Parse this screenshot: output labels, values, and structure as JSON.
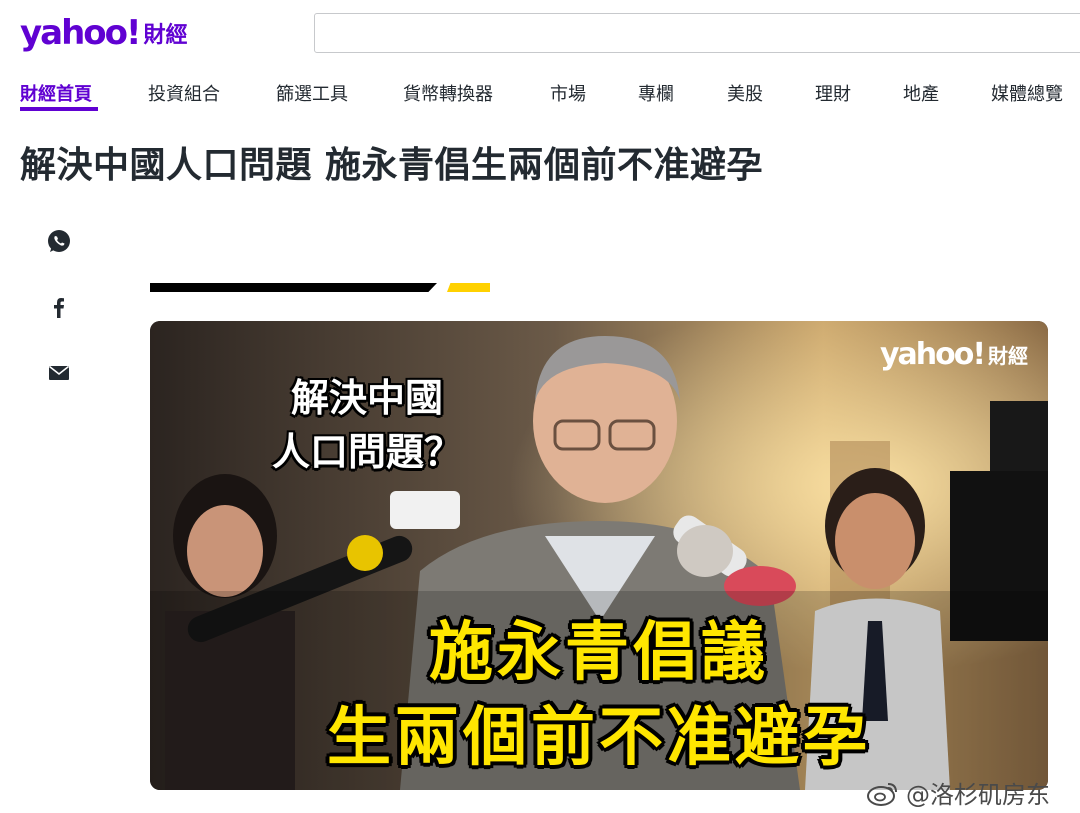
{
  "header": {
    "logo_text": "yahoo!",
    "logo_sub": "財經",
    "search_placeholder": ""
  },
  "nav": {
    "items": [
      {
        "label": "財經首頁",
        "active": true
      },
      {
        "label": "投資組合"
      },
      {
        "label": "篩選工具"
      },
      {
        "label": "貨幣轉換器"
      },
      {
        "label": "市場"
      },
      {
        "label": "專欄"
      },
      {
        "label": "美股"
      },
      {
        "label": "理財"
      },
      {
        "label": "地產"
      },
      {
        "label": "媒體總覽"
      }
    ]
  },
  "article": {
    "title": "解決中國人口問題 施永青倡生兩個前不准避孕"
  },
  "share": {
    "icons": [
      "whatsapp-icon",
      "facebook-icon",
      "mail-icon"
    ]
  },
  "hero": {
    "small_line1": "解決中國",
    "small_line2": "人口問題？",
    "big_line1": "施永青倡議",
    "big_line2": "生兩個前不准避孕",
    "logo_text": "yahoo!",
    "logo_sub": "財經"
  },
  "watermark": {
    "text": "@洛杉矶房东",
    "icon": "weibo-icon"
  },
  "colors": {
    "brand": "#6001d2",
    "accent_yellow": "#ffd100",
    "headline_yellow": "#ffe600"
  }
}
